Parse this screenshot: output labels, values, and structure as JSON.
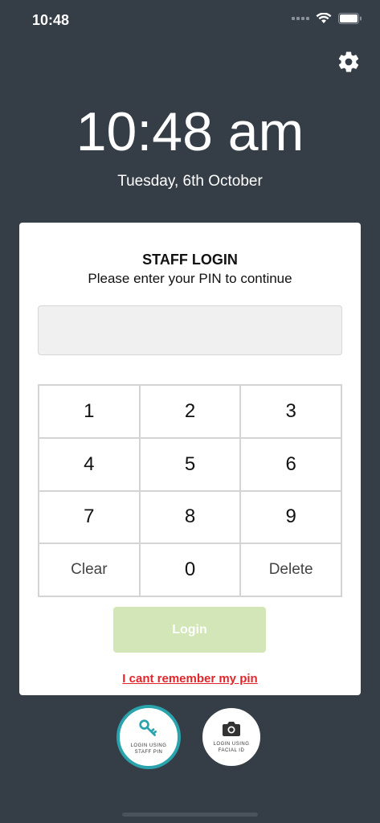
{
  "status_bar": {
    "time": "10:48"
  },
  "header": {
    "clock": "10:48 am",
    "date": "Tuesday, 6th October"
  },
  "login": {
    "title": "STAFF LOGIN",
    "subtitle": "Please enter your PIN to continue",
    "pin_value": "",
    "keys": [
      "1",
      "2",
      "3",
      "4",
      "5",
      "6",
      "7",
      "8",
      "9",
      "Clear",
      "0",
      "Delete"
    ],
    "login_label": "Login",
    "forgot_label": "I cant remember my pin"
  },
  "modes": {
    "pin_label": "LOGIN USING STAFF PIN",
    "face_label": "LOGIN USING FACIAL ID"
  },
  "colors": {
    "background": "#353d47",
    "accent_teal": "#2aa3ac",
    "login_button": "#d2e6b7",
    "link_red": "#e1262b"
  },
  "icons": {
    "settings": "gear-icon",
    "pin_mode": "key-icon",
    "face_mode": "camera-icon"
  }
}
